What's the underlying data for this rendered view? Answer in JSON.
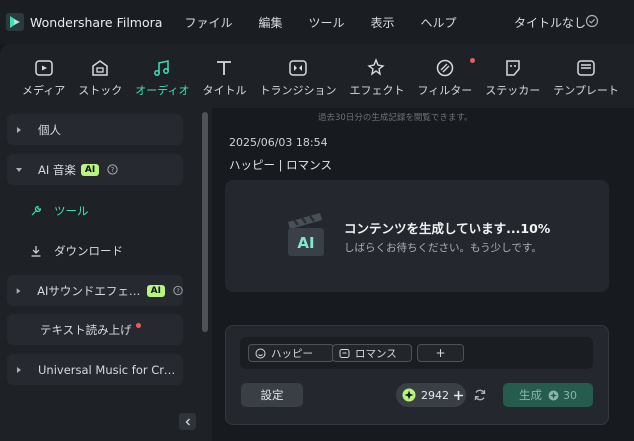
{
  "app": {
    "name": "Wondershare Filmora",
    "project_title": "タイトルなし",
    "menu": [
      "ファイル",
      "編集",
      "ツール",
      "表示",
      "ヘルプ"
    ]
  },
  "toolbar": {
    "items": [
      {
        "label": "メディア",
        "icon": "media-icon"
      },
      {
        "label": "ストック",
        "icon": "stock-icon"
      },
      {
        "label": "オーディオ",
        "icon": "audio-icon",
        "active": true
      },
      {
        "label": "タイトル",
        "icon": "title-icon"
      },
      {
        "label": "トランジション",
        "icon": "transition-icon"
      },
      {
        "label": "エフェクト",
        "icon": "effect-icon"
      },
      {
        "label": "フィルター",
        "icon": "filter-icon",
        "dot": true
      },
      {
        "label": "ステッカー",
        "icon": "sticker-icon"
      },
      {
        "label": "テンプレート",
        "icon": "template-icon"
      }
    ],
    "accent_color": "#3fe0b8"
  },
  "sidebar": {
    "personal": "個人",
    "ai_music": "AI 音楽",
    "ai_badge": "AI",
    "tools": "ツール",
    "download": "ダウンロード",
    "ai_sfx": "AIサウンドエフェクト",
    "tts": "テキスト読み上げ",
    "universal": "Universal Music for Creat..."
  },
  "main": {
    "hint": "過去30日分の生成記録を閲覧できます。",
    "date": "2025/06/03 18:54",
    "tags_line": "ハッピー | ロマンス",
    "generating_title": "コンテンツを生成しています...10%",
    "generating_sub": "しばらくお待ちください。もう少しです。",
    "chips": [
      "ハッピー",
      "ロマンス"
    ],
    "add_chip": "+",
    "settings_label": "設定",
    "credits": "2942",
    "generate_label": "生成",
    "generate_cost": "30"
  }
}
